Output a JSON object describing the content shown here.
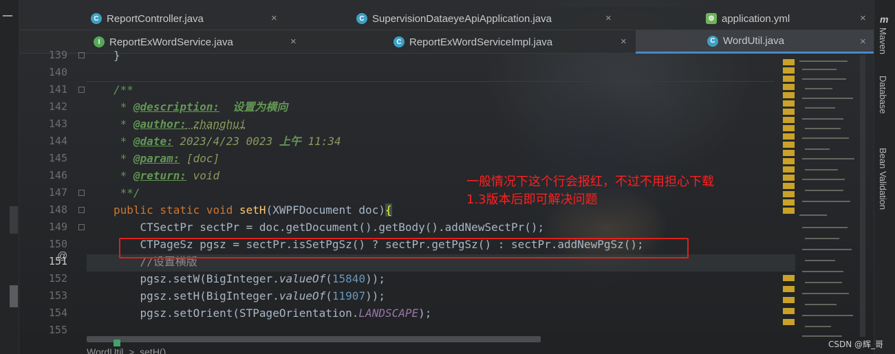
{
  "tabs": {
    "row1": [
      {
        "label": "ReportController.java",
        "icon": "class-icon"
      },
      {
        "label": "SupervisionDataeyeApiApplication.java",
        "icon": "spring-app-icon"
      },
      {
        "label": "application.yml",
        "icon": "yaml-icon"
      }
    ],
    "row2": [
      {
        "label": "ReportExWordService.java",
        "icon": "interface-icon"
      },
      {
        "label": "ReportExWordServiceImpl.java",
        "icon": "class-icon"
      },
      {
        "label": "WordUtil.java",
        "icon": "class-icon",
        "active": true
      }
    ],
    "close_glyph": "×"
  },
  "gutter": {
    "line_numbers": [
      "139",
      "140",
      "141",
      "142",
      "143",
      "144",
      "145",
      "146",
      "147",
      "148",
      "149",
      "150",
      "151",
      "152",
      "153",
      "154",
      "155"
    ],
    "current_line": "151",
    "annotation_glyph": "@"
  },
  "code": {
    "l139": "}",
    "l141": "/**",
    "l142_star": " * ",
    "l142_tag": "@description:",
    "l142_text": "  设置为横向",
    "l143_star": " * ",
    "l143_tag": "@author:",
    "l143_text": " zhanghui",
    "l144_star": " * ",
    "l144_tag": "@date:",
    "l144_text": " 2023/4/23 0023 ",
    "l144_bold": "上午",
    "l144_text2": " 11:34",
    "l145_star": " * ",
    "l145_tag": "@param:",
    "l145_text": " [doc]",
    "l146_star": " * ",
    "l146_tag": "@return:",
    "l146_text": " void",
    "l147": " **/",
    "l148_kw": "public static void ",
    "l148_fn": "setH",
    "l148_args": "(XWPFDocument doc)",
    "l148_brace": "{",
    "l149": "    CTSectPr sectPr = doc.getDocument().getBody().addNewSectPr();",
    "l150": "    CTPageSz pgsz = sectPr.isSetPgSz() ? sectPr.getPgSz() : sectPr.addNewPgSz();",
    "l151": "    //设置横版",
    "l152_a": "    pgsz.setW(BigInteger.",
    "l152_s": "valueOf",
    "l152_b": "(",
    "l152_n": "15840",
    "l152_c": "));",
    "l153_a": "    pgsz.setH(BigInteger.",
    "l153_s": "valueOf",
    "l153_b": "(",
    "l153_n": "11907",
    "l153_c": "));",
    "l154_a": "    pgsz.setOrient(STPageOrientation.",
    "l154_k": "LANDSCAPE",
    "l154_c": ");"
  },
  "annotation": {
    "line1": "一般情况下这个行会报红，不过不用担心下载",
    "line2": "1.3版本后即可解决问题",
    "color": "#ff2020"
  },
  "breadcrumb": "WordUtil  >  setH()",
  "right_panel": {
    "maven_icon": "m",
    "maven": "Maven",
    "database": "Database",
    "bean_validation": "Bean Validation"
  },
  "watermark": "CSDN @辉_哥"
}
